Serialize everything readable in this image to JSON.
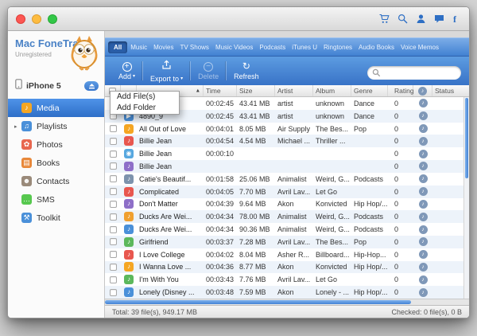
{
  "window": {
    "app_name": "Mac FoneTrans",
    "license": "Unregistered"
  },
  "titlebar": {
    "icons": [
      "cart",
      "search",
      "support",
      "feedback",
      "facebook"
    ]
  },
  "sidebar": {
    "device": {
      "name": "iPhone 5"
    },
    "items": [
      {
        "label": "Media",
        "icon_glyph": "♪",
        "icon_color": "#f5a623",
        "twisty": "",
        "active": true
      },
      {
        "label": "Playlists",
        "icon_glyph": "♫",
        "icon_color": "#4a90d9",
        "twisty": "▸"
      },
      {
        "label": "Photos",
        "icon_glyph": "✿",
        "icon_color": "#e8674f",
        "twisty": ""
      },
      {
        "label": "Books",
        "icon_glyph": "▤",
        "icon_color": "#e8883a",
        "twisty": ""
      },
      {
        "label": "Contacts",
        "icon_glyph": "☻",
        "icon_color": "#9a8a7a",
        "twisty": ""
      },
      {
        "label": "SMS",
        "icon_glyph": "…",
        "icon_color": "#57c84f",
        "twisty": ""
      },
      {
        "label": "Toolkit",
        "icon_glyph": "⚒",
        "icon_color": "#4a90d9",
        "twisty": ""
      }
    ]
  },
  "tabs": [
    {
      "label": "All",
      "active": true
    },
    {
      "label": "Music"
    },
    {
      "label": "Movies"
    },
    {
      "label": "TV Shows"
    },
    {
      "label": "Music Videos"
    },
    {
      "label": "Podcasts"
    },
    {
      "label": "iTunes U"
    },
    {
      "label": "Ringtones"
    },
    {
      "label": "Audio Books"
    },
    {
      "label": "Voice Memos"
    }
  ],
  "toolbar": {
    "add_label": "Add",
    "export_label": "Export to",
    "delete_label": "Delete",
    "refresh_label": "Refresh",
    "icons": {
      "add": "+",
      "delete": "−",
      "refresh": "↻",
      "caret": "▾"
    }
  },
  "add_menu": {
    "items": [
      "Add File(s)",
      "Add Folder"
    ]
  },
  "table": {
    "sort_indicator": "▲",
    "note_glyph": "♪",
    "headers": {
      "time": "Time",
      "size": "Size",
      "artist": "Artist",
      "album": "Album",
      "genre": "Genre",
      "rating": "Rating",
      "status": "Status"
    },
    "rows": [
      {
        "name": "",
        "time": "00:02:45",
        "size": "43.41 MB",
        "artist": "artist",
        "album": "unknown",
        "genre": "Dance",
        "rating": "0",
        "icon_glyph": "♪",
        "icon_color": "#9aa7b8"
      },
      {
        "name": "4890_9",
        "time": "00:02:45",
        "size": "43.41 MB",
        "artist": "artist",
        "album": "unknown",
        "genre": "Dance",
        "rating": "0",
        "icon_glyph": "▶",
        "icon_color": "#4a90d9"
      },
      {
        "name": "All Out of Love",
        "time": "00:04:01",
        "size": "8.05 MB",
        "artist": "Air Supply",
        "album": "The Bes...",
        "genre": "Pop",
        "rating": "0",
        "icon_glyph": "♪",
        "icon_color": "#f5a623"
      },
      {
        "name": "Billie Jean",
        "time": "00:04:54",
        "size": "4.54 MB",
        "artist": "Michael ...",
        "album": "Thriller ...",
        "genre": "",
        "rating": "0",
        "icon_glyph": "♪",
        "icon_color": "#e8574f"
      },
      {
        "name": "Billie Jean",
        "time": "00:00:10",
        "size": "",
        "artist": "",
        "album": "",
        "genre": "",
        "rating": "0",
        "icon_glyph": "◉",
        "icon_color": "#58a8e0"
      },
      {
        "name": "Billie Jean",
        "time": "",
        "size": "",
        "artist": "",
        "album": "",
        "genre": "",
        "rating": "0",
        "icon_glyph": "♪",
        "icon_color": "#8e6fc8"
      },
      {
        "name": "Catie's Beautif...",
        "time": "00:01:58",
        "size": "25.06 MB",
        "artist": "Animalist",
        "album": "Weird, G...",
        "genre": "Podcasts",
        "rating": "0",
        "icon_glyph": "♪",
        "icon_color": "#7d93ad"
      },
      {
        "name": "Complicated",
        "time": "00:04:05",
        "size": "7.70 MB",
        "artist": "Avril Lav...",
        "album": "Let Go",
        "genre": "",
        "rating": "0",
        "icon_glyph": "♪",
        "icon_color": "#e8574f"
      },
      {
        "name": "Don't Matter",
        "time": "00:04:39",
        "size": "9.64 MB",
        "artist": "Akon",
        "album": "Konvicted",
        "genre": "Hip Hop/...",
        "rating": "0",
        "icon_glyph": "♪",
        "icon_color": "#8e6fc8"
      },
      {
        "name": "Ducks Are Wei...",
        "time": "00:04:34",
        "size": "78.00 MB",
        "artist": "Animalist",
        "album": "Weird, G...",
        "genre": "Podcasts",
        "rating": "0",
        "icon_glyph": "♪",
        "icon_color": "#f0a030"
      },
      {
        "name": "Ducks Are Wei...",
        "time": "00:04:34",
        "size": "90.36 MB",
        "artist": "Animalist",
        "album": "Weird, G...",
        "genre": "Podcasts",
        "rating": "0",
        "icon_glyph": "♪",
        "icon_color": "#4a90d9"
      },
      {
        "name": "Girlfriend",
        "time": "00:03:37",
        "size": "7.28 MB",
        "artist": "Avril Lav...",
        "album": "The Bes...",
        "genre": "Pop",
        "rating": "0",
        "icon_glyph": "♪",
        "icon_color": "#5cb85c"
      },
      {
        "name": "I Love College",
        "time": "00:04:02",
        "size": "8.04 MB",
        "artist": "Asher R...",
        "album": "Billboard...",
        "genre": "Hip-Hop...",
        "rating": "0",
        "icon_glyph": "♪",
        "icon_color": "#e8574f"
      },
      {
        "name": "I Wanna Love ...",
        "time": "00:04:36",
        "size": "8.77 MB",
        "artist": "Akon",
        "album": "Konvicted",
        "genre": "Hip Hop/...",
        "rating": "0",
        "icon_glyph": "♪",
        "icon_color": "#f5a623"
      },
      {
        "name": "I'm With You",
        "time": "00:03:43",
        "size": "7.76 MB",
        "artist": "Avril Lav...",
        "album": "Let Go",
        "genre": "",
        "rating": "0",
        "icon_glyph": "♪",
        "icon_color": "#5cb85c"
      },
      {
        "name": "Lonely (Disney ...",
        "time": "00:03:48",
        "size": "7.59 MB",
        "artist": "Akon",
        "album": "Lonely - ...",
        "genre": "Hip Hop/...",
        "rating": "0",
        "icon_glyph": "♪",
        "icon_color": "#4a90d9"
      }
    ]
  },
  "status_bar": {
    "total": "Total: 39 file(s), 949.17 MB",
    "checked": "Checked: 0 file(s), 0 B"
  },
  "colors": {
    "accent_blue": "#3f7fd4",
    "toolbar_top": "#5d9ce1",
    "toolbar_bottom": "#3873c7",
    "selection_blue": "#3b7fd4",
    "zebra_row": "#edf3fa",
    "note_icon": "#7f98b8"
  }
}
